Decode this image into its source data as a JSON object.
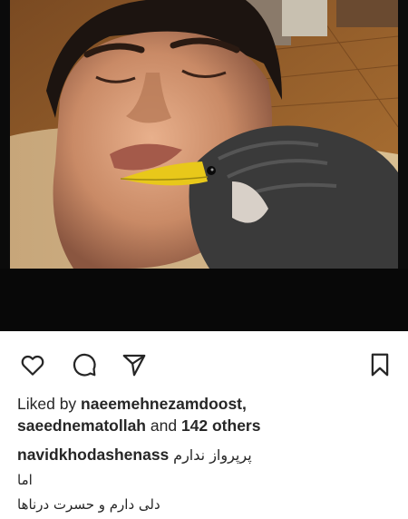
{
  "post": {
    "photo_alt": "selfie-with-myna-bird"
  },
  "actions": {
    "like_icon": "heart-outline-icon",
    "comment_icon": "comment-bubble-icon",
    "share_icon": "paper-plane-icon",
    "save_icon": "bookmark-outline-icon"
  },
  "likes": {
    "prefix": "Liked by ",
    "user1": "naeemehnezamdoost",
    "comma": ",",
    "user2": "saeednematollah",
    "and": " and ",
    "others": "142 others"
  },
  "caption": {
    "username": "navidkhodashenass",
    "text": "پرپرواز ندارم",
    "line2": "اما",
    "line3": "دلی دارم و حسرت درناها"
  },
  "colors": {
    "text": "#262626",
    "frame": "#0b0b0b"
  }
}
